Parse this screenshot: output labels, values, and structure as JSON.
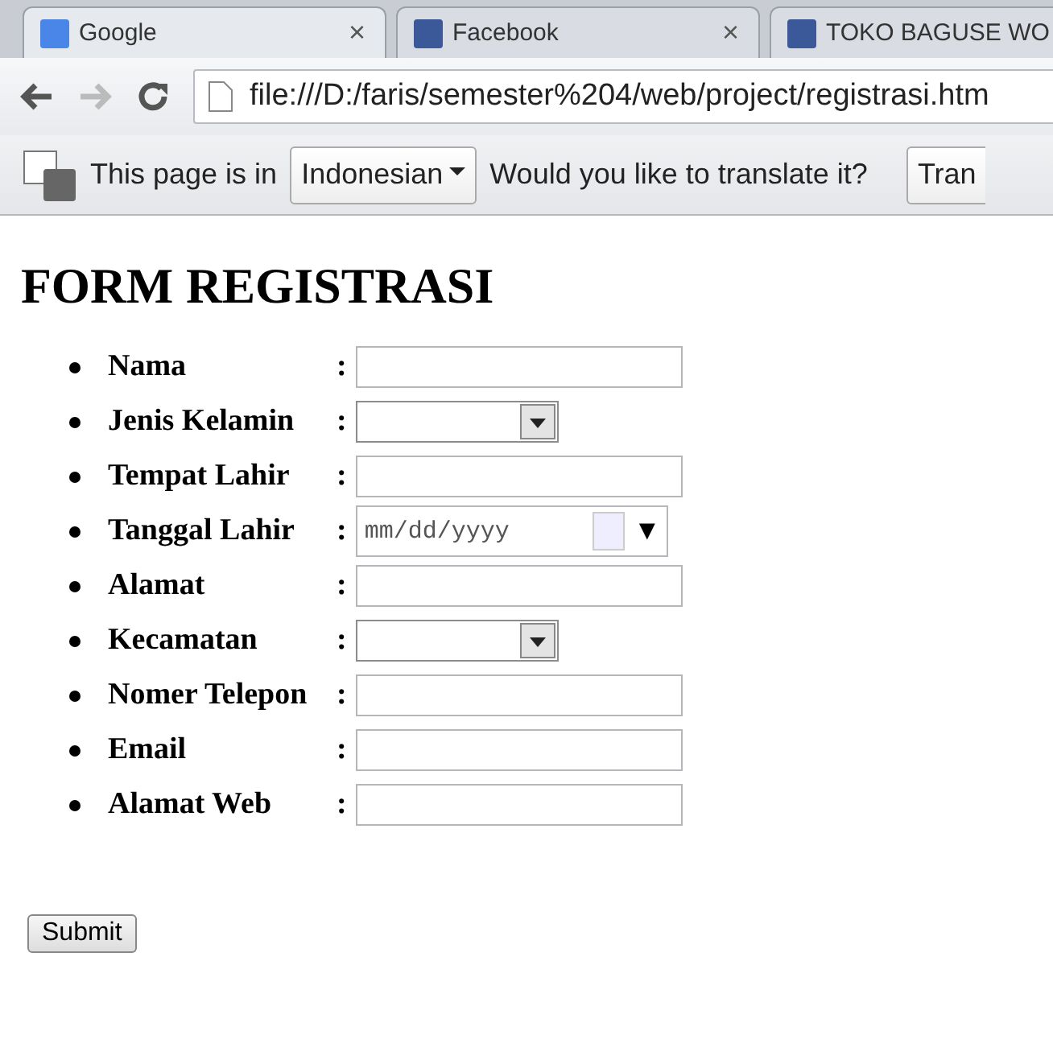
{
  "tabs": [
    {
      "title": "Google",
      "close": "×",
      "selected": true
    },
    {
      "title": "Facebook",
      "close": "×",
      "selected": false
    },
    {
      "title": "TOKO BAGUSE WO",
      "selected": false
    }
  ],
  "address_bar": {
    "url": "file:///D:/faris/semester%204/web/project/registrasi.htm"
  },
  "translate_bar": {
    "text_before": "This page is in",
    "language": "Indonesian",
    "text_after": "Would you like to translate it?",
    "button": "Tran"
  },
  "page": {
    "heading": "FORM REGISTRASI",
    "fields": [
      {
        "label": "Nama",
        "colon": ":",
        "kind": "text"
      },
      {
        "label": "Jenis Kelamin",
        "colon": ":",
        "kind": "select"
      },
      {
        "label": "Tempat Lahir",
        "colon": ":",
        "kind": "text"
      },
      {
        "label": "Tanggal Lahir",
        "colon": ":",
        "kind": "date",
        "placeholder": "mm/dd/yyyy",
        "picker": "▼"
      },
      {
        "label": "Alamat",
        "colon": ":",
        "kind": "text"
      },
      {
        "label": "Kecamatan",
        "colon": ":",
        "kind": "select"
      },
      {
        "label": "Nomer Telepon",
        "colon": ":",
        "kind": "text"
      },
      {
        "label": "Email",
        "colon": ":",
        "kind": "text"
      },
      {
        "label": "Alamat Web",
        "colon": ":",
        "kind": "text"
      }
    ],
    "submit": "Submit"
  }
}
